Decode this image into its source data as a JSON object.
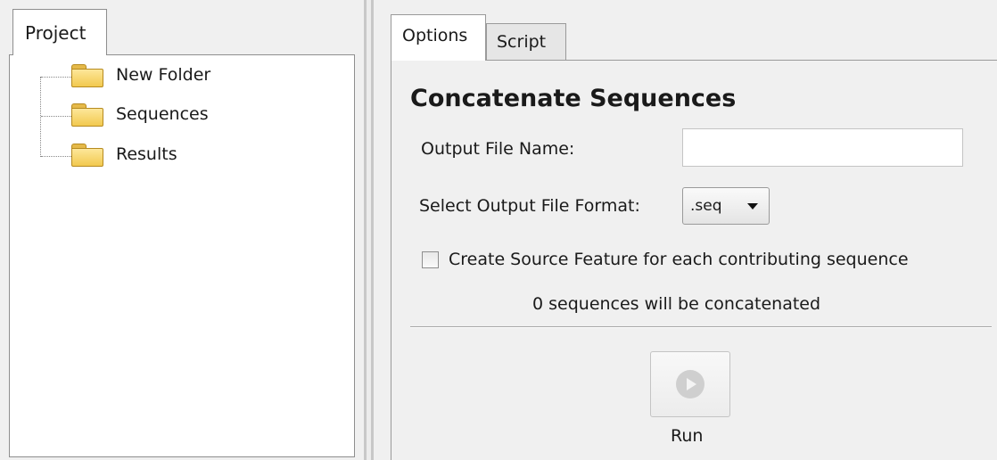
{
  "project_panel": {
    "tab_label": "Project",
    "tree": [
      {
        "label": "New Folder",
        "icon": "folder-icon"
      },
      {
        "label": "Sequences",
        "icon": "folder-icon"
      },
      {
        "label": "Results",
        "icon": "folder-icon"
      }
    ]
  },
  "tabs": [
    {
      "label": "Options",
      "active": true
    },
    {
      "label": "Script",
      "active": false
    }
  ],
  "options": {
    "title": "Concatenate Sequences",
    "output_name_label": "Output File Name:",
    "output_name_value": "",
    "format_label": "Select Output File Format:",
    "format_value": ".seq",
    "checkbox_label": "Create Source Feature for each contributing sequence",
    "checkbox_checked": false,
    "status_text": "0 sequences will be concatenated",
    "run_label": "Run"
  },
  "colors": {
    "background": "#f0f0f0",
    "folder_yellow": "#f2c94f"
  }
}
